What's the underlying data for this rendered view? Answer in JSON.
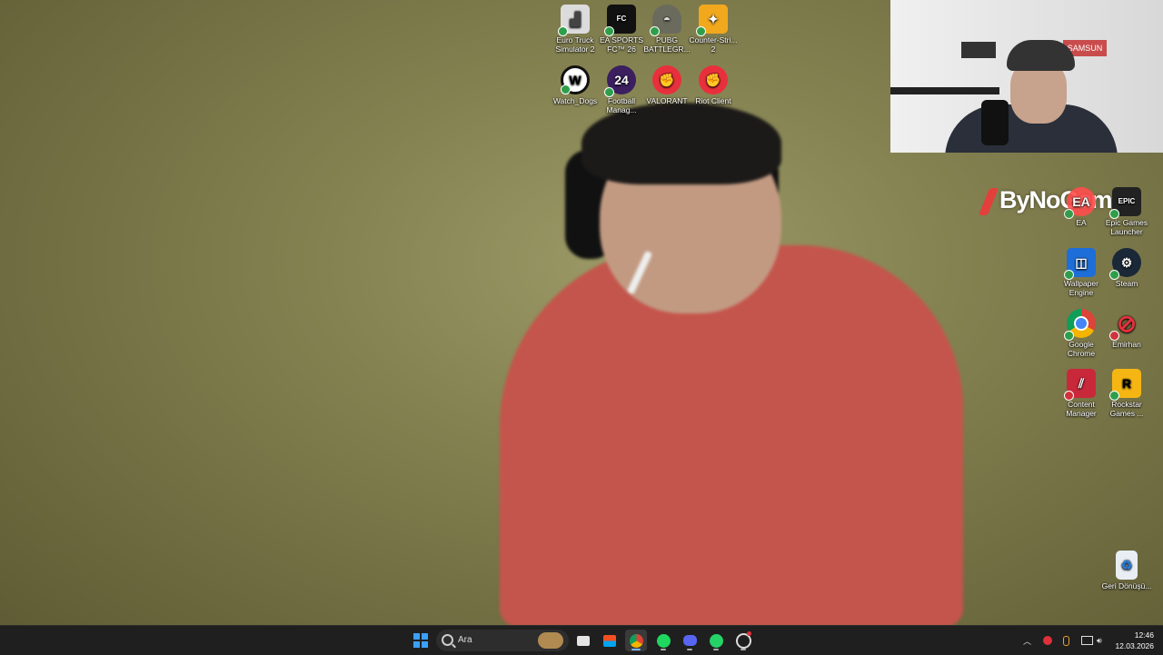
{
  "desktop": {
    "top_icons": [
      {
        "label": "Euro Truck Simulator 2",
        "icon": "truck-icon"
      },
      {
        "label": "EA SPORTS FC™ 26",
        "icon": "ea-fc-icon"
      },
      {
        "label": "PUBG BATTLEGR...",
        "icon": "pubg-icon"
      },
      {
        "label": "Counter-Stri... 2",
        "icon": "counter-strike-icon"
      },
      {
        "label": "Watch_Dogs",
        "icon": "watch-dogs-icon"
      },
      {
        "label": "Football Manag...",
        "icon": "football-manager-icon",
        "badge": "24"
      },
      {
        "label": "VALORANT",
        "icon": "riot-icon"
      },
      {
        "label": "Riot Client",
        "icon": "riot-icon"
      }
    ],
    "right_icons": [
      {
        "label": "EA",
        "icon": "ea-icon"
      },
      {
        "label": "Epic Games Launcher",
        "icon": "epic-games-icon",
        "badge": "EPIC"
      },
      {
        "label": "Wallpaper Engine",
        "icon": "wallpaper-engine-icon"
      },
      {
        "label": "Steam",
        "icon": "steam-icon"
      },
      {
        "label": "Google Chrome",
        "icon": "chrome-icon"
      },
      {
        "label": "Emirhan",
        "icon": "emirhan-icon"
      },
      {
        "label": "Content Manager",
        "icon": "content-manager-icon"
      },
      {
        "label": "Rockstar Games ...",
        "icon": "rockstar-icon",
        "badge": "R"
      },
      {
        "label": "Geri Dönüşü...",
        "icon": "recycle-bin-icon"
      }
    ]
  },
  "watermark": "ByNoGame",
  "webcam": {
    "sign_text": "SAMSUN"
  },
  "taskbar": {
    "search_placeholder": "Ara",
    "pinned": [
      "file-explorer-icon",
      "store-icon",
      "chrome-icon",
      "spotify-icon",
      "discord-icon",
      "whatsapp-icon",
      "obs-icon"
    ],
    "time": "12:46",
    "date": "12.03.2026"
  }
}
